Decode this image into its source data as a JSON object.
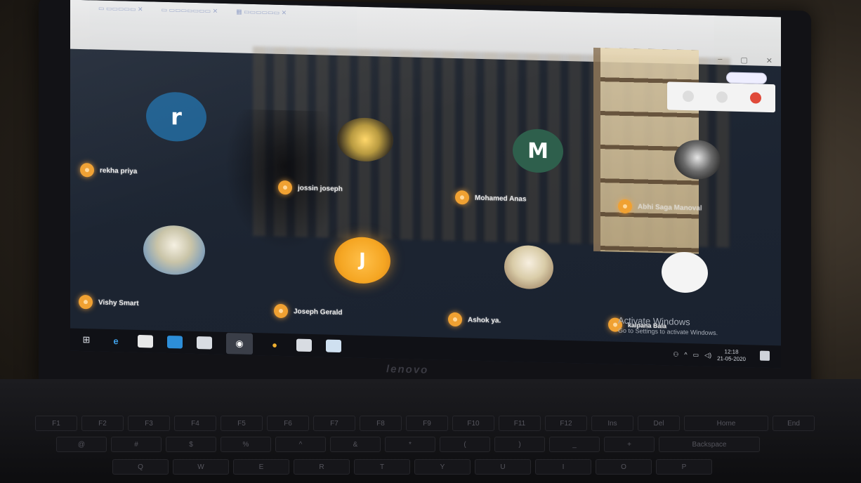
{
  "participants": [
    {
      "name": "rekha priya",
      "initial": "r",
      "avatar_color": "#1f5f8f"
    },
    {
      "name": "jossin joseph",
      "initial": "",
      "avatar_color": ""
    },
    {
      "name": "Mohamed Anas",
      "initial": "M",
      "avatar_color": "#2e5f4c"
    },
    {
      "name": "Abhi Saga Manoval",
      "initial": "",
      "avatar_color": ""
    },
    {
      "name": "Vishy Smart",
      "initial": "",
      "avatar_color": ""
    },
    {
      "name": "Joseph Gerald",
      "initial": "J",
      "avatar_color": "#f5a623"
    },
    {
      "name": "Ashok ya.",
      "initial": "",
      "avatar_color": ""
    },
    {
      "name": "kalpana Bala",
      "initial": "",
      "avatar_color": "#f4f4f4"
    }
  ],
  "activation": {
    "title": "Activate Windows",
    "subtitle": "Go to Settings to activate Windows."
  },
  "taskbar": {
    "clock_time": "12:18",
    "clock_date": "21-05-2020"
  },
  "laptop": {
    "brand": "lenovo"
  },
  "keyboard": {
    "fn_row": [
      "F1",
      "F2",
      "F3",
      "F4",
      "F5",
      "F6",
      "F7",
      "F8",
      "F9",
      "F10",
      "F11",
      "F12",
      "Ins",
      "Del",
      "Home",
      "End"
    ],
    "num_row": [
      "@",
      "#",
      "$",
      "%",
      "^",
      "&",
      "*",
      "(",
      ")",
      "_",
      "+",
      "Backspace"
    ],
    "alpha_row": [
      "Q",
      "W",
      "E",
      "R",
      "T",
      "Y",
      "U",
      "I",
      "O",
      "P"
    ]
  },
  "colors": {
    "mic_indicator": "#f0a132",
    "screen_bg": "#1f2734"
  }
}
